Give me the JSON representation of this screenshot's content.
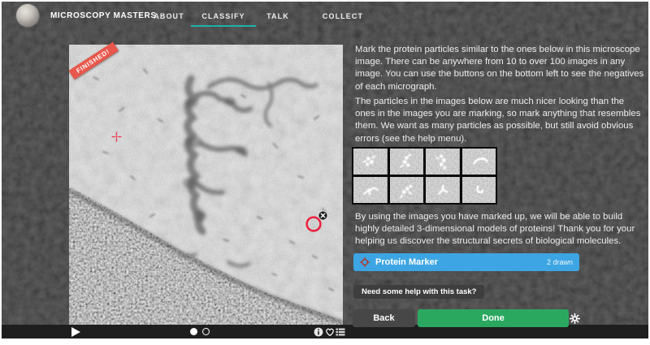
{
  "nav": {
    "brand": "MICROSCOPY MASTERS",
    "items": [
      {
        "label": "ABOUT"
      },
      {
        "label": "CLASSIFY"
      },
      {
        "label": "TALK"
      },
      {
        "label": "COLLECT"
      }
    ],
    "active_item": "CLASSIFY"
  },
  "subject": {
    "ribbon_label": "FINISHED!",
    "markers_drawn": 2
  },
  "viewer_toolbar": {
    "icons": [
      "play-icon",
      "slide-dot-filled",
      "slide-dot-outline",
      "info-icon",
      "heart-icon",
      "metadata-icon"
    ]
  },
  "task": {
    "instructions": [
      "Mark the protein particles similar to the ones below in this microscope image. There can be anywhere from 10 to over 100 images in any image. You can use the buttons on the bottom left to see the negatives of each micrograph.",
      "The particles in the images below are much nicer looking than the ones in the images you are marking, so mark anything that resembles them. We want as many particles as possible, but still avoid obvious errors (see the help menu).",
      "By using the images you have marked up, we will be able to build highly detailed 3-dimensional models of proteins! Thank you for your helping us discover the structural secrets of biological molecules."
    ],
    "marker_button": {
      "label": "Protein Marker",
      "count_label": "2 drawn",
      "icon": "crosshair-circle-icon"
    },
    "help_button_label": "Need some help with this task?",
    "back_label": "Back",
    "done_label": "Done"
  },
  "colors": {
    "accent_teal": "#1fb1aa",
    "ribbon_orange": "#e8574b",
    "marker_button_blue": "#3da5e3",
    "done_green": "#2ba860",
    "marker_red": "#ec1f3d",
    "nav_background": "#2e2e2e"
  }
}
